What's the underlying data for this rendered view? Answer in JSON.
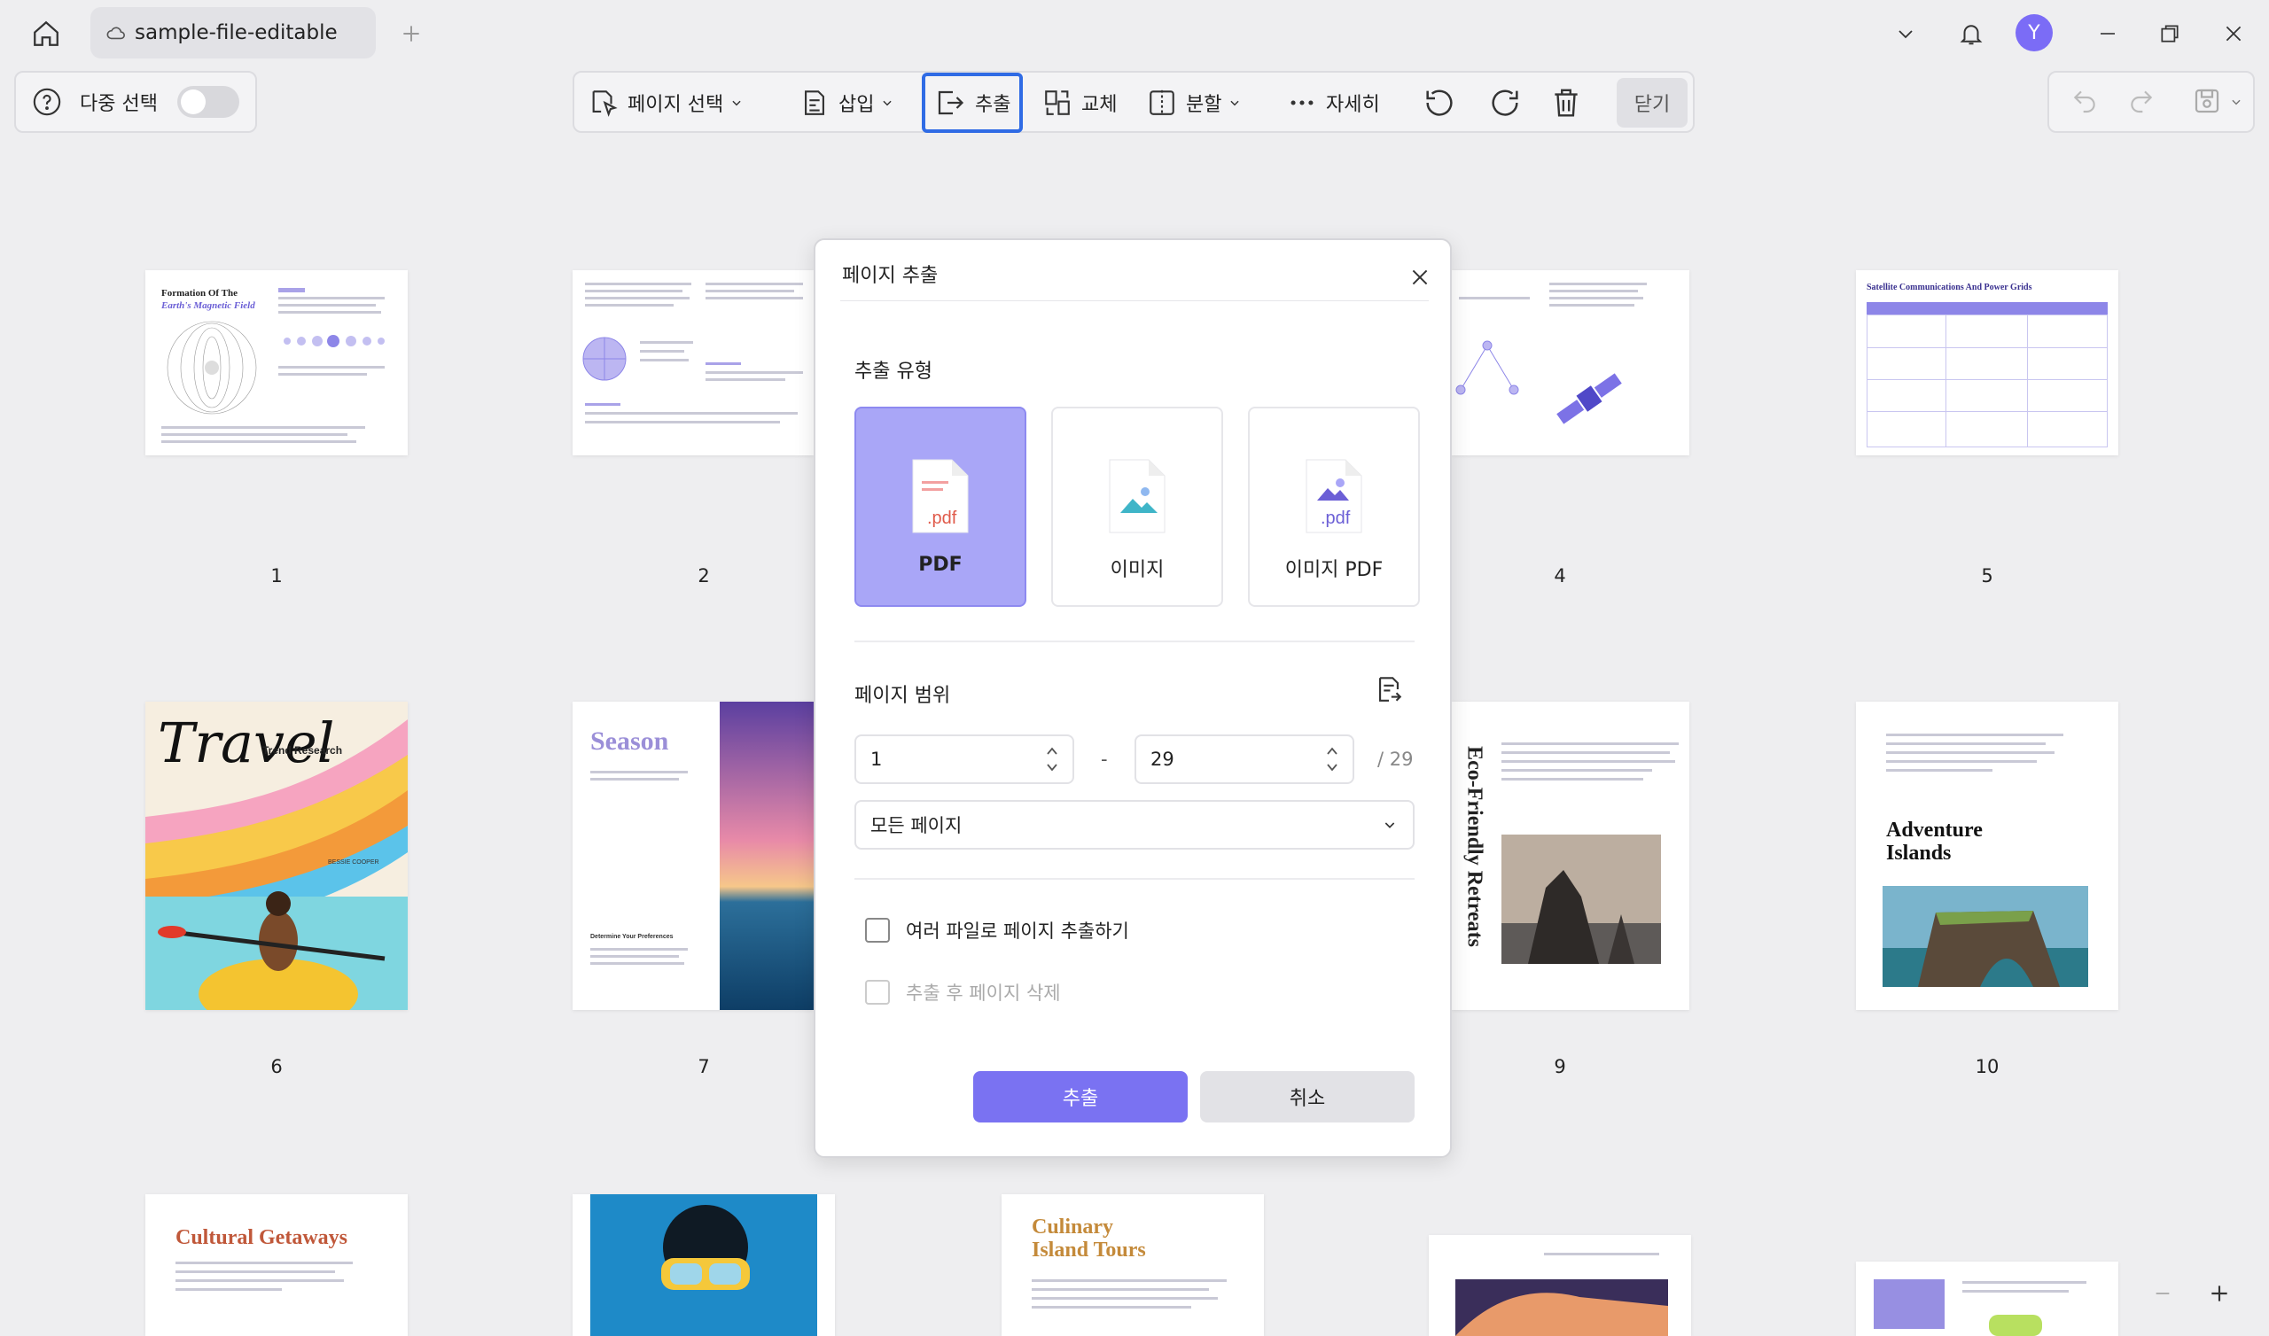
{
  "titlebar": {
    "tab_title": "sample-file-editable",
    "avatar_initial": "Y"
  },
  "toolbar": {
    "multi_select_label": "다중 선택",
    "page_select_label": "페이지 선택",
    "insert_label": "삽입",
    "extract_label": "추출",
    "replace_label": "교체",
    "split_label": "분할",
    "more_label": "자세히",
    "close_label": "닫기"
  },
  "pages": [
    {
      "num": "1",
      "title_a": "Formation Of The",
      "title_b": "Earth's Magnetic Field"
    },
    {
      "num": "2"
    },
    {
      "num": "4"
    },
    {
      "num": "5",
      "title": "Satellite Communications And Power Grids"
    },
    {
      "num": "6",
      "title": "Travel",
      "subtitle": "Trend Research",
      "author": "BESSIE COOPER"
    },
    {
      "num": "7",
      "title": "Season",
      "subtitle": "Determine Your Preferences"
    },
    {
      "num": "9",
      "title": "Eco-Friendly Retreats"
    },
    {
      "num": "10",
      "title_a": "Adventure",
      "title_b": "Islands"
    },
    {
      "title": "Cultural Getaways"
    },
    {
      "title_a": "Culinary",
      "title_b": "Island Tours"
    }
  ],
  "modal": {
    "title": "페이지 추출",
    "type_section_label": "추출 유형",
    "types": [
      {
        "label": "PDF",
        "selected": true
      },
      {
        "label": "이미지",
        "selected": false
      },
      {
        "label": "이미지 PDF",
        "selected": false
      }
    ],
    "file_ext": ".pdf",
    "range_section_label": "페이지 범위",
    "range_from": "1",
    "range_to": "29",
    "range_total": "/ 29",
    "range_dash": "-",
    "page_filter": "모든 페이지",
    "option_multi_files": "여러 파일로 페이지 추출하기",
    "option_delete_after": "추출 후 페이지 삭제",
    "extract_button": "추출",
    "cancel_button": "취소"
  },
  "colors": {
    "accent": "#7a72f2",
    "active_border": "#2f6be5",
    "selected_card": "#a9a6f7"
  }
}
